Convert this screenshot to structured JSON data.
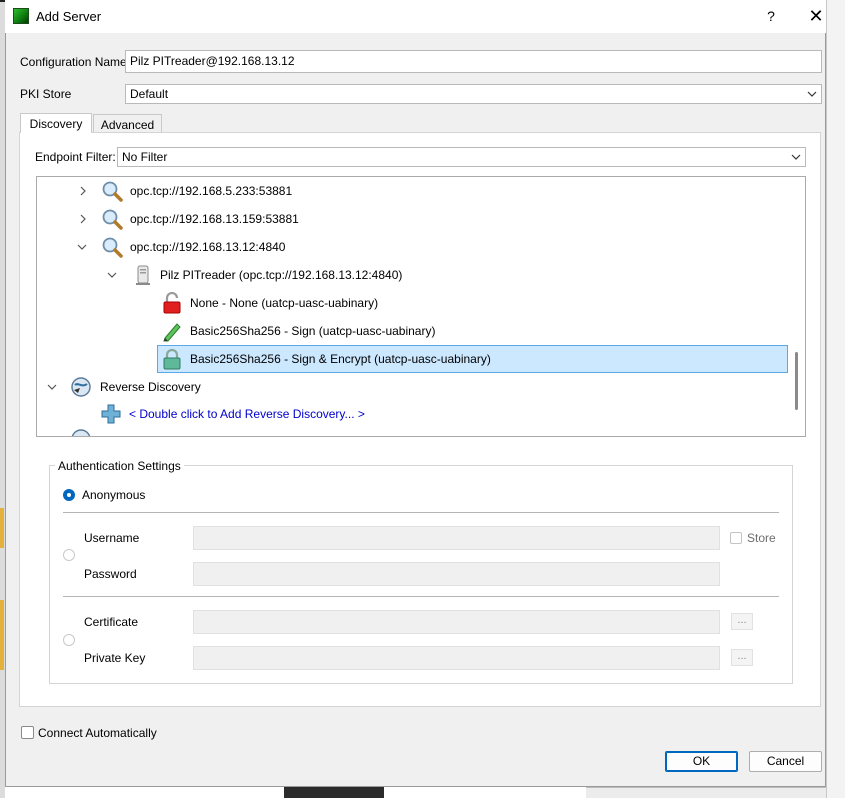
{
  "window": {
    "title": "Add Server",
    "help_label": "?",
    "close_label": "✕"
  },
  "form": {
    "config_name_label": "Configuration Name",
    "config_name_value": "Pilz PITreader@192.168.13.12",
    "pki_store_label": "PKI Store",
    "pki_store_value": "Default"
  },
  "tabs": [
    {
      "label": "Discovery",
      "active": true
    },
    {
      "label": "Advanced",
      "active": false
    }
  ],
  "discovery": {
    "endpoint_filter_label": "Endpoint Filter:",
    "endpoint_filter_value": "No Filter",
    "tree": [
      {
        "label": "opc.tcp://192.168.5.233:53881",
        "icon": "search-icon",
        "expanded": false
      },
      {
        "label": "opc.tcp://192.168.13.159:53881",
        "icon": "search-icon",
        "expanded": false
      },
      {
        "label": "opc.tcp://192.168.13.12:4840",
        "icon": "search-icon",
        "expanded": true
      },
      {
        "label": "Pilz PITreader (opc.tcp://192.168.13.12:4840)",
        "icon": "server-icon",
        "expanded": true
      },
      {
        "label": "None - None (uatcp-uasc-uabinary)",
        "icon": "unlocked-icon"
      },
      {
        "label": "Basic256Sha256 - Sign (uatcp-uasc-uabinary)",
        "icon": "pencil-icon"
      },
      {
        "label": "Basic256Sha256 - Sign & Encrypt (uatcp-uasc-uabinary)",
        "icon": "locked-icon",
        "selected": true
      },
      {
        "label": "Reverse Discovery",
        "icon": "globe-icon",
        "expanded": true
      },
      {
        "label": "< Double click to Add Reverse Discovery... >",
        "icon": "add-icon"
      }
    ]
  },
  "auth": {
    "title": "Authentication Settings",
    "anonymous_label": "Anonymous",
    "username_label": "Username",
    "password_label": "Password",
    "store_label": "Store",
    "certificate_label": "Certificate",
    "private_key_label": "Private Key",
    "browse_label": "..."
  },
  "footer": {
    "connect_auto_label": "Connect Automatically",
    "ok_label": "OK",
    "cancel_label": "Cancel"
  },
  "colors": {
    "accent": "#0067c0",
    "selection": "#cce8ff",
    "link": "#0000cc"
  }
}
